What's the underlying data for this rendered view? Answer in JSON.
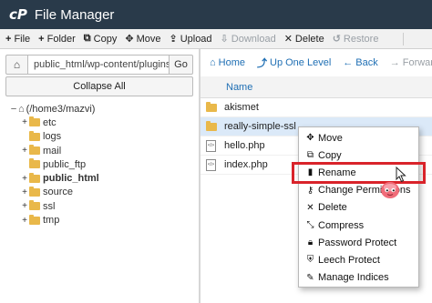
{
  "app": {
    "logo": "cP",
    "title": "File Manager"
  },
  "toolbar": {
    "file": "File",
    "folder": "Folder",
    "copy": "Copy",
    "move": "Move",
    "upload": "Upload",
    "download": "Download",
    "delete": "Delete",
    "restore": "Restore"
  },
  "left": {
    "path_value": "public_html/wp-content/plugins",
    "go": "Go",
    "collapse_all": "Collapse All",
    "tree": {
      "root": "(/home3/mazvi)",
      "items": [
        "etc",
        "logs",
        "mail",
        "public_ftp",
        "public_html",
        "source",
        "ssl",
        "tmp"
      ]
    }
  },
  "nav": {
    "home": "Home",
    "up": "Up One Level",
    "back": "Back",
    "forward": "Forward"
  },
  "files": {
    "header_name": "Name",
    "rows": [
      "akismet",
      "really-simple-ssl",
      "hello.php",
      "index.php"
    ]
  },
  "context_menu": {
    "items": [
      "Move",
      "Copy",
      "Rename",
      "Change Permissions",
      "Delete",
      "Compress",
      "Password Protect",
      "Leech Protect",
      "Manage Indices"
    ]
  },
  "colors": {
    "titlebar": "#293a4a",
    "link": "#1f6fb4",
    "highlight": "#d9232a",
    "folder": "#e9b84a"
  }
}
